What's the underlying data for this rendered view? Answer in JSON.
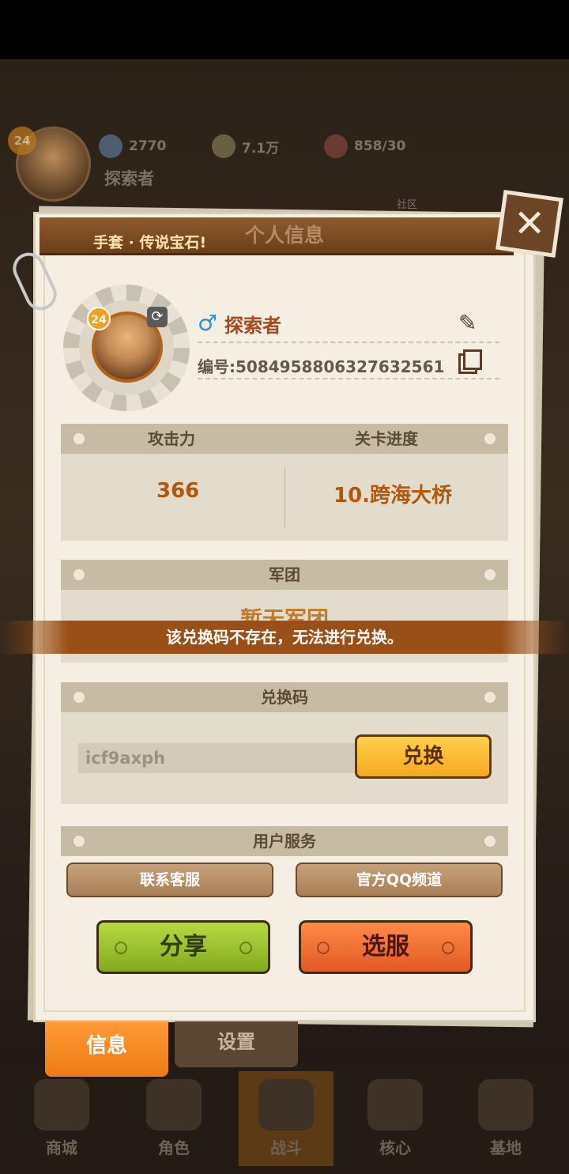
{
  "background": {
    "level": "24",
    "player_name": "探索者",
    "resources": [
      {
        "icon": "gem-icon",
        "value": "2770"
      },
      {
        "icon": "coin-icon",
        "value": "7.1万"
      },
      {
        "icon": "meat-icon",
        "value": "858/30"
      }
    ],
    "community_label": "社区",
    "bottom_nav": [
      "商城",
      "角色",
      "战斗",
      "核心",
      "基地"
    ]
  },
  "header": {
    "title": "个人信息",
    "ticker": "手套 · 传说宝石!",
    "close_icon": "✕"
  },
  "profile": {
    "level": "24",
    "gender_symbol": "♂",
    "name": "探索者",
    "id_text": "编号:5084958806327632561",
    "edit_icon": "✎"
  },
  "stats": {
    "attack_label": "攻击力",
    "progress_label": "关卡进度",
    "attack_value": "366",
    "progress_value": "10.跨海大桥"
  },
  "legion": {
    "label": "军团",
    "value": "暂无军团"
  },
  "toast": "该兑换码不存在，无法进行兑换。",
  "redeem": {
    "label": "兑换码",
    "input_value": "icf9axph",
    "button": "兑换"
  },
  "service": {
    "label": "用户服务",
    "contact": "联系客服",
    "qq": "官方QQ频道"
  },
  "actions": {
    "share": "分享",
    "select_server": "选服"
  },
  "tabs": {
    "info": "信息",
    "settings": "设置"
  },
  "colors": {
    "accent_orange": "#ee7a15",
    "header_brown": "#6c3f19",
    "share_green": "#83aa1d",
    "server_red": "#e15a22",
    "redeem_yellow": "#f5a91f"
  }
}
